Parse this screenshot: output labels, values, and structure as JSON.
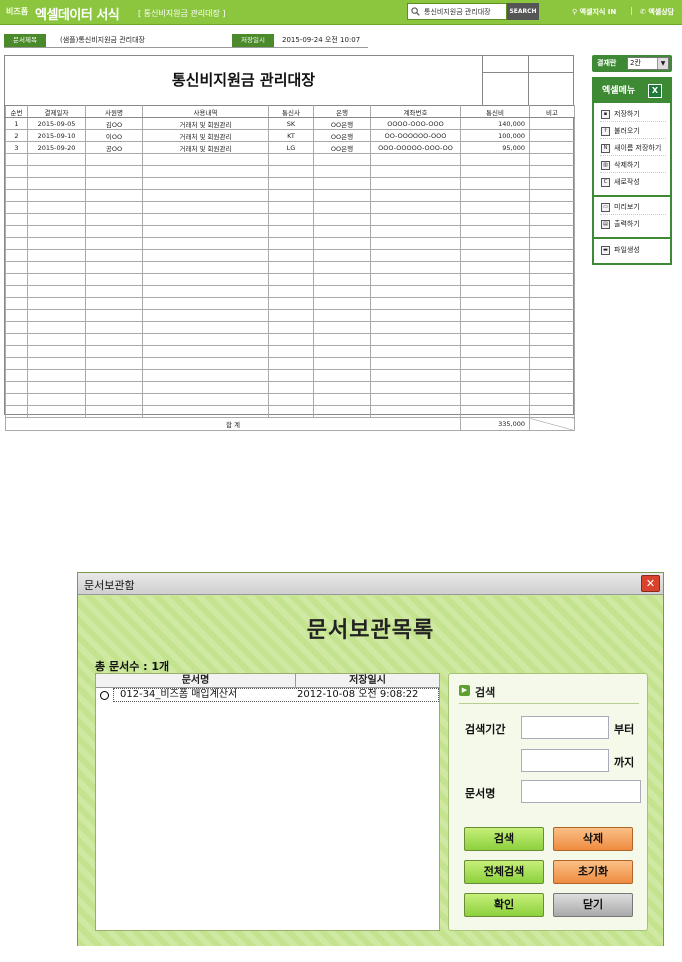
{
  "topbar": {
    "brand_small": "비즈폼",
    "brand": "엑셀데이터 서식",
    "doc_tag": "[ 통신비지원금 관리대장 ]",
    "search_value": "통신비지원금 관리대장",
    "search_button": "SEARCH",
    "link_knowledge": "엑셀지식 IN",
    "separator": "|",
    "link_consult": "엑셀상담"
  },
  "infobar": {
    "title_label": "문서제목",
    "title_value": "(샘플)통신비지원금 관리대장",
    "saved_label": "저장일시",
    "saved_value": "2015-09-24  오전 10:07"
  },
  "sheet": {
    "title": "통신비지원금 관리대장",
    "columns": [
      "순번",
      "결제일자",
      "사원명",
      "사용내역",
      "통신사",
      "은행",
      "계좌번호",
      "통신비",
      "비고"
    ],
    "rows": [
      [
        "1",
        "2015-09-05",
        "김OO",
        "거래처 및 회원관리",
        "SK",
        "OO은행",
        "OOOO-OOO-OOO",
        "140,000",
        ""
      ],
      [
        "2",
        "2015-09-10",
        "이OO",
        "거래처 및 회원관리",
        "KT",
        "OO은행",
        "OO-OOOOOO-OOO",
        "100,000",
        ""
      ],
      [
        "3",
        "2015-09-20",
        "공OO",
        "거래처 및 회원관리",
        "LG",
        "OO은행",
        "OOO-OOOOO-OOO-OO",
        "95,000",
        ""
      ]
    ],
    "total_label": "합      계",
    "total_value": "335,000"
  },
  "right_panel": {
    "approval_label": "결재란",
    "approval_value": "2칸",
    "menu_title": "엑셀메뉴",
    "menu_items": [
      "저장하기",
      "불러오기",
      "새이름 저장하기",
      "삭제하기",
      "새로작성",
      "미리보기",
      "출력하기",
      "파일생성"
    ]
  },
  "dialog": {
    "window_title": "문서보관함",
    "heading": "문서보관목록",
    "doc_count": "총 문서수 : 1개",
    "list_headers": [
      "문서명",
      "저장일시"
    ],
    "list_rows": [
      {
        "name": "012-34_비즈폼 매입계산서",
        "saved": "2012-10-08 오전 9:08:22"
      }
    ],
    "search_title": "검색",
    "period_label": "검색기간",
    "from_suffix": "부터",
    "to_suffix": "까지",
    "docname_label": "문서명",
    "buttons": {
      "search": "검색",
      "delete": "삭제",
      "search_all": "전체검색",
      "reset": "초기화",
      "ok": "확인",
      "close": "닫기"
    }
  },
  "colors": {
    "topbar_green": "#8cc63f",
    "menu_green": "#3e8a34",
    "dialog_bg": "#c9e796"
  }
}
